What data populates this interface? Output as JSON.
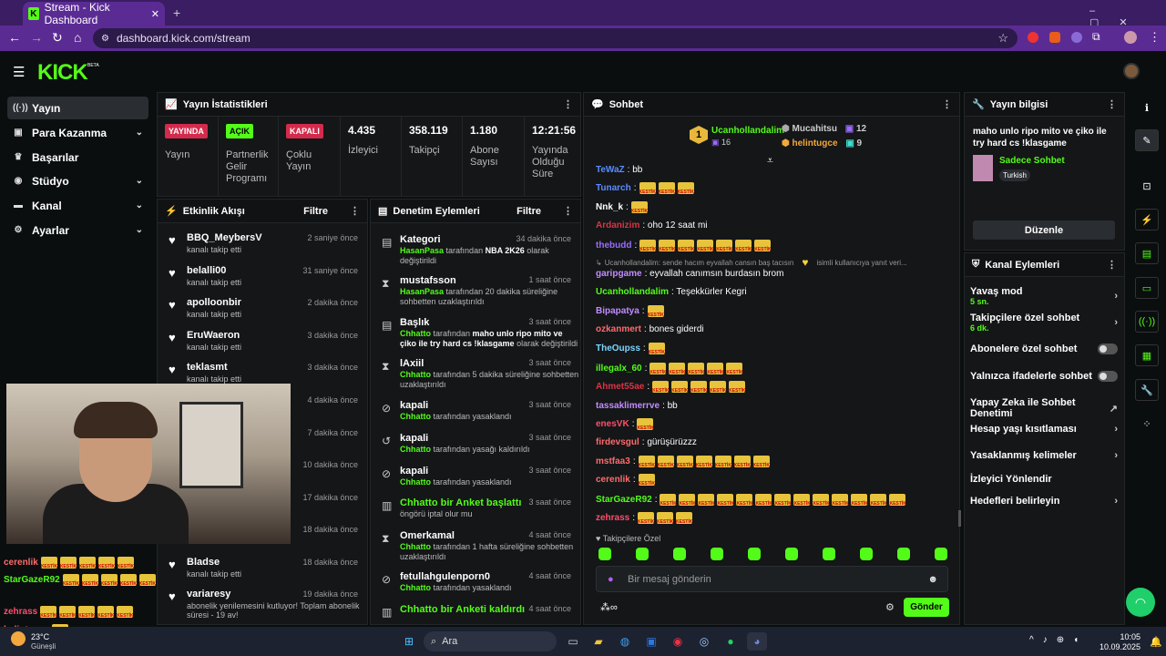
{
  "browser": {
    "tab_title": "Stream - Kick Dashboard",
    "url": "dashboard.kick.com/stream"
  },
  "app": {
    "logo": "KICK",
    "beta": "BETA"
  },
  "sidebar": {
    "items": [
      {
        "label": "Yayın",
        "icon": "signal-icon"
      },
      {
        "label": "Para Kazanma",
        "icon": "money-icon"
      },
      {
        "label": "Başarılar",
        "icon": "trophy-icon"
      },
      {
        "label": "Stüdyo",
        "icon": "studio-icon"
      },
      {
        "label": "Kanal",
        "icon": "channel-icon"
      },
      {
        "label": "Ayarlar",
        "icon": "gear-icon"
      }
    ]
  },
  "stats": {
    "title": "Yayın İstatistikleri",
    "live_badge": "YAYINDA",
    "live_label": "Yayın",
    "partner_badge": "AÇIK",
    "partner_label": "Partnerlik Gelir Programı",
    "multi_badge": "KAPALI",
    "multi_label": "Çoklu Yayın",
    "viewers": "4.435",
    "viewers_label": "İzleyici",
    "followers": "358.119",
    "followers_label": "Takipçi",
    "subs": "1.180",
    "subs_label": "Abone Sayısı",
    "uptime": "12:21:56",
    "uptime_label": "Yayında Olduğu Süre"
  },
  "activity": {
    "title": "Etkinlik Akışı",
    "filter": "Filtre",
    "events": [
      {
        "user": "BBQ_MeybersV",
        "desc": "kanalı takip etti",
        "time": "2 saniye önce"
      },
      {
        "user": "belalli00",
        "desc": "kanalı takip etti",
        "time": "31 saniye önce"
      },
      {
        "user": "apolloonbir",
        "desc": "kanalı takip etti",
        "time": "2 dakika önce"
      },
      {
        "user": "EruWaeron",
        "desc": "kanalı takip etti",
        "time": "3 dakika önce"
      },
      {
        "user": "teklasmt",
        "desc": "kanalı takip etti",
        "time": "3 dakika önce"
      },
      {
        "time": "4 dakika önce"
      },
      {
        "time": "7 dakika önce"
      },
      {
        "time": "10 dakika önce"
      },
      {
        "time": "17 dakika önce"
      },
      {
        "time": "18 dakika önce"
      },
      {
        "user": "Bladse",
        "desc": "kanalı takip etti",
        "time": "18 dakika önce"
      },
      {
        "user": "variaresy",
        "desc": "abonelik yenilemesini kutluyor! Toplam abonelik süresi - 19 av!",
        "time": "19 dakika önce"
      }
    ]
  },
  "moderation": {
    "title": "Denetim Eylemleri",
    "filter": "Filtre",
    "items": [
      {
        "title": "Kategori",
        "time": "34 dakika önce",
        "parts": [
          [
            "g",
            "HasanPasa"
          ],
          [
            "n",
            " tarafından "
          ],
          [
            "w",
            "NBA 2K26"
          ],
          [
            "n",
            " olarak değiştirildi"
          ]
        ]
      },
      {
        "title": "mustafsson",
        "time": "1 saat önce",
        "parts": [
          [
            "g",
            "HasanPasa"
          ],
          [
            "n",
            " tarafından 20 dakika süreliğine sohbetten uzaklaştırıldı"
          ]
        ]
      },
      {
        "title": "Başlık",
        "time": "3 saat önce",
        "parts": [
          [
            "g",
            "Chhatto"
          ],
          [
            "n",
            " tarafından "
          ],
          [
            "w",
            "maho unlo ripo mito ve çiko ile try hard cs !klasgame"
          ],
          [
            "n",
            " olarak değiştirildi"
          ]
        ]
      },
      {
        "title": "lAxiil",
        "time": "3 saat önce",
        "parts": [
          [
            "g",
            "Chhatto"
          ],
          [
            "n",
            " tarafından 5 dakika süreliğine sohbetten uzaklaştırıldı"
          ]
        ]
      },
      {
        "title": "kapali",
        "time": "3 saat önce",
        "parts": [
          [
            "g",
            "Chhatto"
          ],
          [
            "n",
            " tarafından yasaklandı"
          ]
        ]
      },
      {
        "title": "kapali",
        "time": "3 saat önce",
        "parts": [
          [
            "g",
            "Chhatto"
          ],
          [
            "n",
            " tarafından yasağı kaldırıldı"
          ]
        ]
      },
      {
        "title": "kapali",
        "time": "3 saat önce",
        "parts": [
          [
            "g",
            "Chhatto"
          ],
          [
            "n",
            " tarafından yasaklandı"
          ]
        ]
      },
      {
        "title": "Chhatto bir Anket başlattı",
        "time": "3 saat önce",
        "parts": [
          [
            "n",
            "öngörü iptal olur mu"
          ]
        ]
      },
      {
        "title": "Omerkamal",
        "time": "4 saat önce",
        "parts": [
          [
            "g",
            "Chhatto"
          ],
          [
            "n",
            " tarafından 1 hafta süreliğine sohbetten uzaklaştırıldı"
          ]
        ]
      },
      {
        "title": "fetullahgulenporn0",
        "time": "4 saat önce",
        "parts": [
          [
            "g",
            "Chhatto"
          ],
          [
            "n",
            " tarafından yasaklandı"
          ]
        ]
      },
      {
        "title": "Chhatto bir Anketi kaldırdı",
        "time": "4 saat önce",
        "parts": []
      }
    ]
  },
  "chat": {
    "title": "Sohbet",
    "top": [
      {
        "rank": "1",
        "name": "Ucanhollandalim",
        "count": "16"
      },
      {
        "name": "Mucahitsu",
        "count": "12"
      },
      {
        "name": "helintugce",
        "count": "9"
      }
    ],
    "messages": [
      {
        "u": "TeWaZ",
        "c": "#5b8cff",
        "text": ": bb"
      },
      {
        "u": "Tunarch",
        "c": "#5b8cff",
        "emotes": 3
      },
      {
        "u": "Nnk_k",
        "c": "#fff",
        "emotes": 1
      },
      {
        "u": "Ardanizim",
        "c": "#d34",
        "text": ": oho 12 saat mi"
      },
      {
        "u": "thebudd",
        "c": "#9b6bff",
        "emotes": 7
      },
      {
        "reply": "Ucanhollandalim: sende hacım eyvallah cansın baş tacısın",
        "reply2": "isimli kullanıcıya yanıt veri..."
      },
      {
        "u": "garipgame",
        "c": "#c38cff",
        "text": ": eyvallah canımsın burdasın brom"
      },
      {
        "u": "Ucanhollandalim",
        "c": "#53fc18",
        "text": ": Teşekkürler Kegri"
      },
      {
        "u": "Bipapatya",
        "c": "#c38cff",
        "emotes": 1
      },
      {
        "u": "ozkanmert",
        "c": "#ff6b6b",
        "text": ": bones giderdi"
      },
      {
        "u": "TheOupss",
        "c": "#7bd7ff",
        "emotes": 1
      },
      {
        "u": "illegalx_60",
        "c": "#53fc18",
        "emotes": 5
      },
      {
        "u": "Ahmet55ae",
        "c": "#d34",
        "emotes": 5
      },
      {
        "u": "tassaklimerrve",
        "c": "#c38cff",
        "text": ": bb"
      },
      {
        "u": "enesVK",
        "c": "#ff4d6d",
        "emotes": 1
      },
      {
        "u": "firdevsgul",
        "c": "#ff6b6b",
        "text": ": gürüşürüzzz"
      },
      {
        "u": "mstfaa3",
        "c": "#ff6b6b",
        "emotes": 7
      },
      {
        "u": "cerenlik",
        "c": "#ff6b6b",
        "emotes": 1
      },
      {
        "u": "StarGazeR92",
        "c": "#53fc18",
        "emotes": 13
      },
      {
        "u": "zehrass",
        "c": "#ff4d6d",
        "emotes": 3
      }
    ],
    "followers_only": "Takipçilere Özel",
    "placeholder": "Bir mesaj gönderin",
    "send": "Gönder"
  },
  "info": {
    "title": "Yayın bilgisi",
    "stream_title": "maho unlo ripo mito ve çiko ile try hard cs !klasgame",
    "category": "Sadece Sohbet",
    "language": "Turkish",
    "edit": "Düzenle"
  },
  "actions": {
    "title": "Kanal Eylemleri",
    "items": [
      {
        "label": "Yavaş mod",
        "sub": "5 sn.",
        "type": "chev"
      },
      {
        "label": "Takipçilere özel sohbet",
        "sub": "6 dk.",
        "type": "chev"
      },
      {
        "label": "Abonelere özel sohbet",
        "type": "toggle"
      },
      {
        "label": "Yalnızca ifadelerle sohbet",
        "type": "toggle"
      },
      {
        "label": "Yapay Zeka ile Sohbet Denetimi",
        "type": "ext"
      },
      {
        "label": "Hesap yaşı kısıtlaması",
        "type": "chev"
      },
      {
        "label": "Yasaklanmış kelimeler",
        "type": "chev"
      },
      {
        "label": "İzleyici Yönlendir",
        "type": "none"
      },
      {
        "label": "Hedefleri belirleyin",
        "type": "chev"
      }
    ]
  },
  "overlay": [
    {
      "u": "cerenlik",
      "c": "#ff6b6b"
    },
    {
      "u": "StarGazeR92",
      "c": "#53fc18"
    },
    {
      "u": "zehrass",
      "c": "#ff4d6d"
    },
    {
      "u": "helintugce",
      "c": "#ff6b6b"
    }
  ],
  "taskbar": {
    "weather": "23°C",
    "weather_desc": "Güneşli",
    "search": "Ara",
    "time": "10:05",
    "date": "10.09.2025"
  },
  "colors": {
    "accent": "#53fc18",
    "browser": "#5b2b94"
  }
}
